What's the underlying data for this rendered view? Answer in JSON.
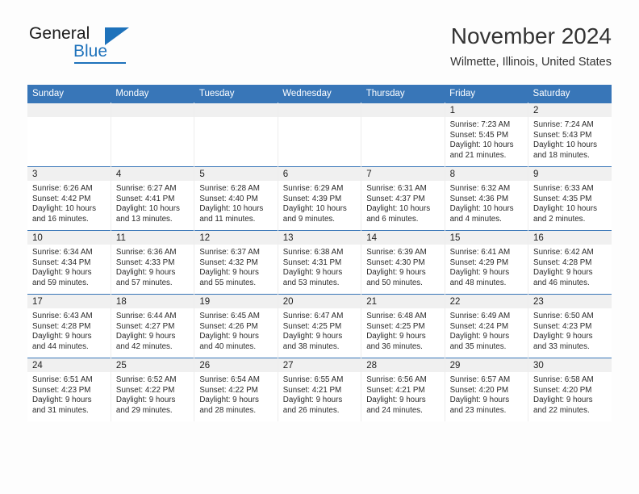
{
  "brand": {
    "name_part1": "General",
    "name_part2": "Blue",
    "triangle_icon": "triangle-icon",
    "accent_color": "#1e72bb"
  },
  "header": {
    "title": "November 2024",
    "location": "Wilmette, Illinois, United States"
  },
  "calendar": {
    "header_bg": "#3876b8",
    "daynum_bg": "#f0f0f0",
    "weekdays": [
      "Sunday",
      "Monday",
      "Tuesday",
      "Wednesday",
      "Thursday",
      "Friday",
      "Saturday"
    ],
    "weeks": [
      [
        {
          "day": "",
          "empty": true
        },
        {
          "day": "",
          "empty": true
        },
        {
          "day": "",
          "empty": true
        },
        {
          "day": "",
          "empty": true
        },
        {
          "day": "",
          "empty": true
        },
        {
          "day": "1",
          "sunrise": "Sunrise: 7:23 AM",
          "sunset": "Sunset: 5:45 PM",
          "daylight": "Daylight: 10 hours and 21 minutes."
        },
        {
          "day": "2",
          "sunrise": "Sunrise: 7:24 AM",
          "sunset": "Sunset: 5:43 PM",
          "daylight": "Daylight: 10 hours and 18 minutes."
        }
      ],
      [
        {
          "day": "3",
          "sunrise": "Sunrise: 6:26 AM",
          "sunset": "Sunset: 4:42 PM",
          "daylight": "Daylight: 10 hours and 16 minutes."
        },
        {
          "day": "4",
          "sunrise": "Sunrise: 6:27 AM",
          "sunset": "Sunset: 4:41 PM",
          "daylight": "Daylight: 10 hours and 13 minutes."
        },
        {
          "day": "5",
          "sunrise": "Sunrise: 6:28 AM",
          "sunset": "Sunset: 4:40 PM",
          "daylight": "Daylight: 10 hours and 11 minutes."
        },
        {
          "day": "6",
          "sunrise": "Sunrise: 6:29 AM",
          "sunset": "Sunset: 4:39 PM",
          "daylight": "Daylight: 10 hours and 9 minutes."
        },
        {
          "day": "7",
          "sunrise": "Sunrise: 6:31 AM",
          "sunset": "Sunset: 4:37 PM",
          "daylight": "Daylight: 10 hours and 6 minutes."
        },
        {
          "day": "8",
          "sunrise": "Sunrise: 6:32 AM",
          "sunset": "Sunset: 4:36 PM",
          "daylight": "Daylight: 10 hours and 4 minutes."
        },
        {
          "day": "9",
          "sunrise": "Sunrise: 6:33 AM",
          "sunset": "Sunset: 4:35 PM",
          "daylight": "Daylight: 10 hours and 2 minutes."
        }
      ],
      [
        {
          "day": "10",
          "sunrise": "Sunrise: 6:34 AM",
          "sunset": "Sunset: 4:34 PM",
          "daylight": "Daylight: 9 hours and 59 minutes."
        },
        {
          "day": "11",
          "sunrise": "Sunrise: 6:36 AM",
          "sunset": "Sunset: 4:33 PM",
          "daylight": "Daylight: 9 hours and 57 minutes."
        },
        {
          "day": "12",
          "sunrise": "Sunrise: 6:37 AM",
          "sunset": "Sunset: 4:32 PM",
          "daylight": "Daylight: 9 hours and 55 minutes."
        },
        {
          "day": "13",
          "sunrise": "Sunrise: 6:38 AM",
          "sunset": "Sunset: 4:31 PM",
          "daylight": "Daylight: 9 hours and 53 minutes."
        },
        {
          "day": "14",
          "sunrise": "Sunrise: 6:39 AM",
          "sunset": "Sunset: 4:30 PM",
          "daylight": "Daylight: 9 hours and 50 minutes."
        },
        {
          "day": "15",
          "sunrise": "Sunrise: 6:41 AM",
          "sunset": "Sunset: 4:29 PM",
          "daylight": "Daylight: 9 hours and 48 minutes."
        },
        {
          "day": "16",
          "sunrise": "Sunrise: 6:42 AM",
          "sunset": "Sunset: 4:28 PM",
          "daylight": "Daylight: 9 hours and 46 minutes."
        }
      ],
      [
        {
          "day": "17",
          "sunrise": "Sunrise: 6:43 AM",
          "sunset": "Sunset: 4:28 PM",
          "daylight": "Daylight: 9 hours and 44 minutes."
        },
        {
          "day": "18",
          "sunrise": "Sunrise: 6:44 AM",
          "sunset": "Sunset: 4:27 PM",
          "daylight": "Daylight: 9 hours and 42 minutes."
        },
        {
          "day": "19",
          "sunrise": "Sunrise: 6:45 AM",
          "sunset": "Sunset: 4:26 PM",
          "daylight": "Daylight: 9 hours and 40 minutes."
        },
        {
          "day": "20",
          "sunrise": "Sunrise: 6:47 AM",
          "sunset": "Sunset: 4:25 PM",
          "daylight": "Daylight: 9 hours and 38 minutes."
        },
        {
          "day": "21",
          "sunrise": "Sunrise: 6:48 AM",
          "sunset": "Sunset: 4:25 PM",
          "daylight": "Daylight: 9 hours and 36 minutes."
        },
        {
          "day": "22",
          "sunrise": "Sunrise: 6:49 AM",
          "sunset": "Sunset: 4:24 PM",
          "daylight": "Daylight: 9 hours and 35 minutes."
        },
        {
          "day": "23",
          "sunrise": "Sunrise: 6:50 AM",
          "sunset": "Sunset: 4:23 PM",
          "daylight": "Daylight: 9 hours and 33 minutes."
        }
      ],
      [
        {
          "day": "24",
          "sunrise": "Sunrise: 6:51 AM",
          "sunset": "Sunset: 4:23 PM",
          "daylight": "Daylight: 9 hours and 31 minutes."
        },
        {
          "day": "25",
          "sunrise": "Sunrise: 6:52 AM",
          "sunset": "Sunset: 4:22 PM",
          "daylight": "Daylight: 9 hours and 29 minutes."
        },
        {
          "day": "26",
          "sunrise": "Sunrise: 6:54 AM",
          "sunset": "Sunset: 4:22 PM",
          "daylight": "Daylight: 9 hours and 28 minutes."
        },
        {
          "day": "27",
          "sunrise": "Sunrise: 6:55 AM",
          "sunset": "Sunset: 4:21 PM",
          "daylight": "Daylight: 9 hours and 26 minutes."
        },
        {
          "day": "28",
          "sunrise": "Sunrise: 6:56 AM",
          "sunset": "Sunset: 4:21 PM",
          "daylight": "Daylight: 9 hours and 24 minutes."
        },
        {
          "day": "29",
          "sunrise": "Sunrise: 6:57 AM",
          "sunset": "Sunset: 4:20 PM",
          "daylight": "Daylight: 9 hours and 23 minutes."
        },
        {
          "day": "30",
          "sunrise": "Sunrise: 6:58 AM",
          "sunset": "Sunset: 4:20 PM",
          "daylight": "Daylight: 9 hours and 22 minutes."
        }
      ]
    ]
  }
}
